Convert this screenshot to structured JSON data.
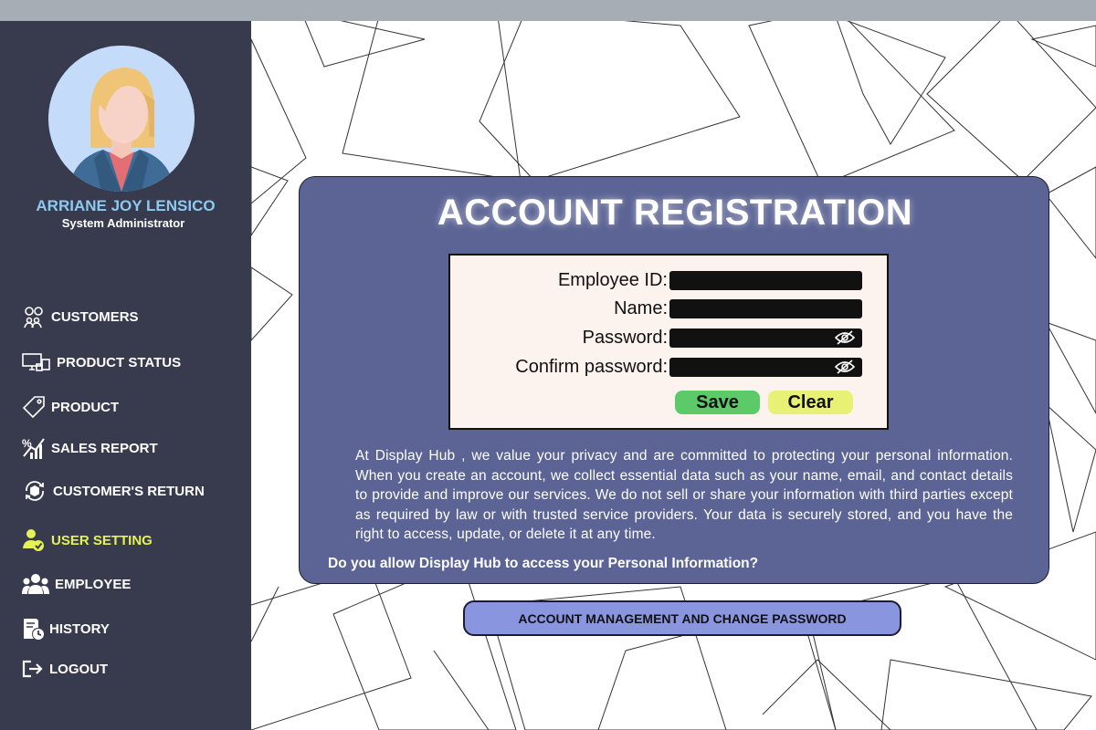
{
  "user": {
    "name": "ARRIANE JOY LENSICO",
    "role": "System Administrator"
  },
  "nav": [
    {
      "label": "CUSTOMERS",
      "icon": "customers-icon"
    },
    {
      "label": "PRODUCT STATUS",
      "icon": "product-status-icon"
    },
    {
      "label": "PRODUCT",
      "icon": "tag-icon"
    },
    {
      "label": "SALES REPORT",
      "icon": "sales-report-icon"
    },
    {
      "label": "CUSTOMER'S RETURN",
      "icon": "return-icon"
    },
    {
      "label": "USER SETTING",
      "icon": "user-setting-icon",
      "active": true
    },
    {
      "label": "EMPLOYEE",
      "icon": "employee-icon"
    },
    {
      "label": "HISTORY",
      "icon": "history-icon"
    },
    {
      "label": "LOGOUT",
      "icon": "logout-icon"
    }
  ],
  "form": {
    "title": "ACCOUNT REGISTRATION",
    "fields": {
      "employee_id": {
        "label": "Employee ID:",
        "value": ""
      },
      "name": {
        "label": "Name:",
        "value": ""
      },
      "password": {
        "label": "Password:",
        "value": ""
      },
      "confirm_password": {
        "label": "Confirm password:",
        "value": ""
      }
    },
    "save_label": "Save",
    "clear_label": "Clear"
  },
  "privacy_text": "At Display Hub , we value your privacy and are committed to protecting your personal information. When you create an account, we collect essential data such as your name, email, and contact details to provide and improve our services. We do not sell or share your information with third parties except as required by law or with trusted service providers. Your data is securely stored, and you have the right to access, update, or delete it at any time.",
  "consent_question": "Do you allow Display Hub to access your Personal Information?",
  "account_button_label": "ACCOUNT MANAGEMENT AND CHANGE PASSWORD",
  "colors": {
    "sidebar": "#383b4e",
    "panel": "#5b6494",
    "active_nav": "#e4f257",
    "user_name": "#8ec9ef",
    "save": "#5dca6a",
    "clear": "#e9f175",
    "account_button": "#8a95df"
  }
}
